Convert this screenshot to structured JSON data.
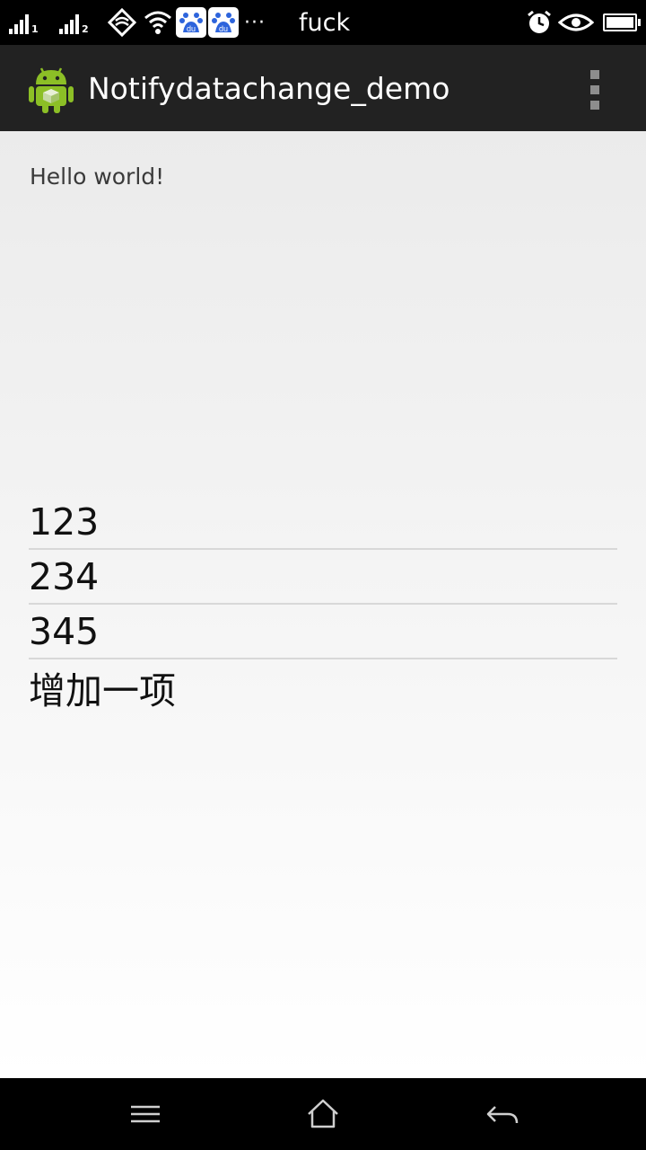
{
  "status_bar": {
    "sim1": "1",
    "sim2": "2",
    "overflow": "···",
    "carrier": "fuck",
    "baidu_label": "du",
    "icons": [
      "signal-icon",
      "signal-icon",
      "network-icon",
      "wifi-icon",
      "baidu-icon",
      "baidu-icon",
      "alarm-icon",
      "eye-icon",
      "battery-icon"
    ]
  },
  "action_bar": {
    "title": "Notifydatachange_demo",
    "background": "#222222",
    "icons": [
      "android-icon",
      "overflow-menu-icon"
    ]
  },
  "content": {
    "hello": "Hello world!",
    "list_items": [
      "123",
      "234",
      "345"
    ],
    "add_item_label": "增加一项"
  },
  "nav_bar": {
    "icons": [
      "menu-icon",
      "home-icon",
      "back-icon"
    ]
  }
}
